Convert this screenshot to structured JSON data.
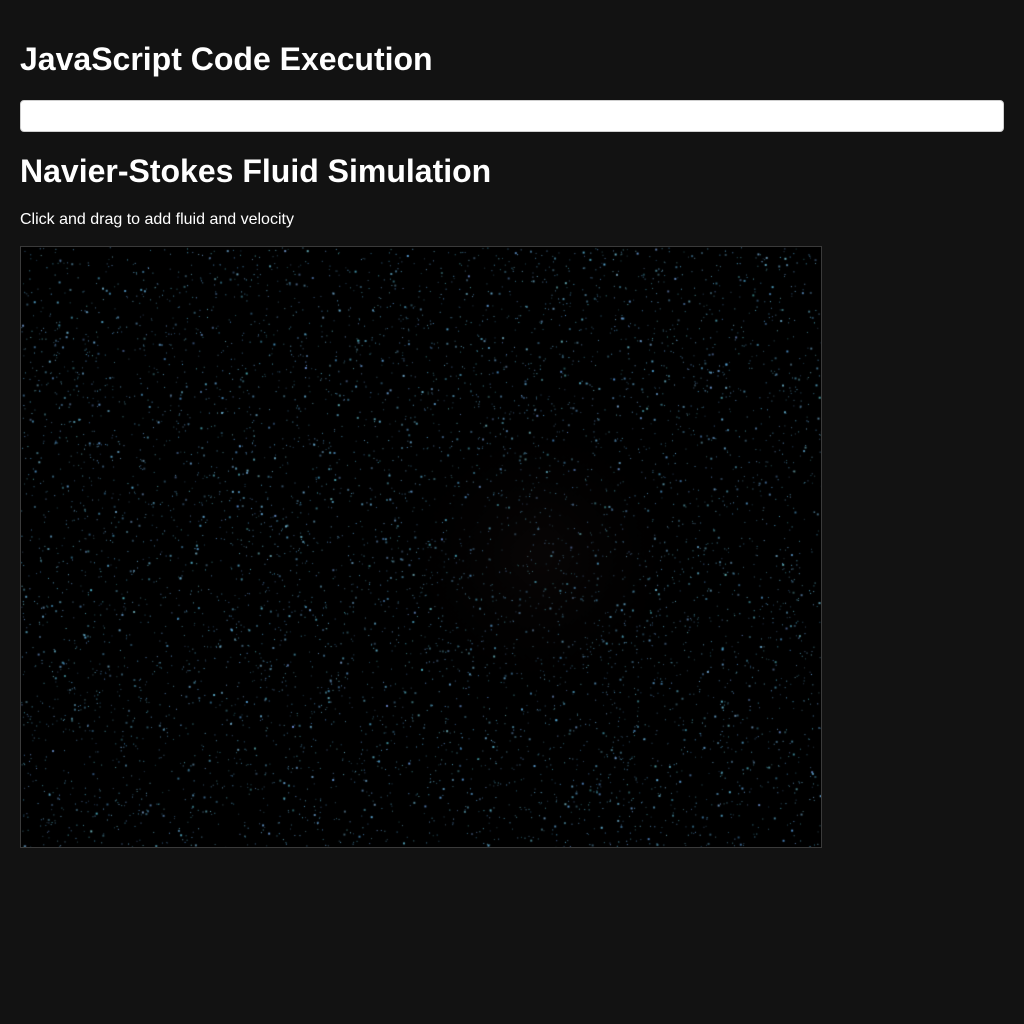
{
  "page": {
    "title": "JavaScript Code Execution",
    "code_input": {
      "value": "",
      "placeholder": ""
    },
    "simulation": {
      "title": "Navier-Stokes Fluid Simulation",
      "instructions": "Click and drag to add fluid and velocity",
      "background_color": "#000000",
      "particle_color": "#4fa3c7"
    }
  }
}
